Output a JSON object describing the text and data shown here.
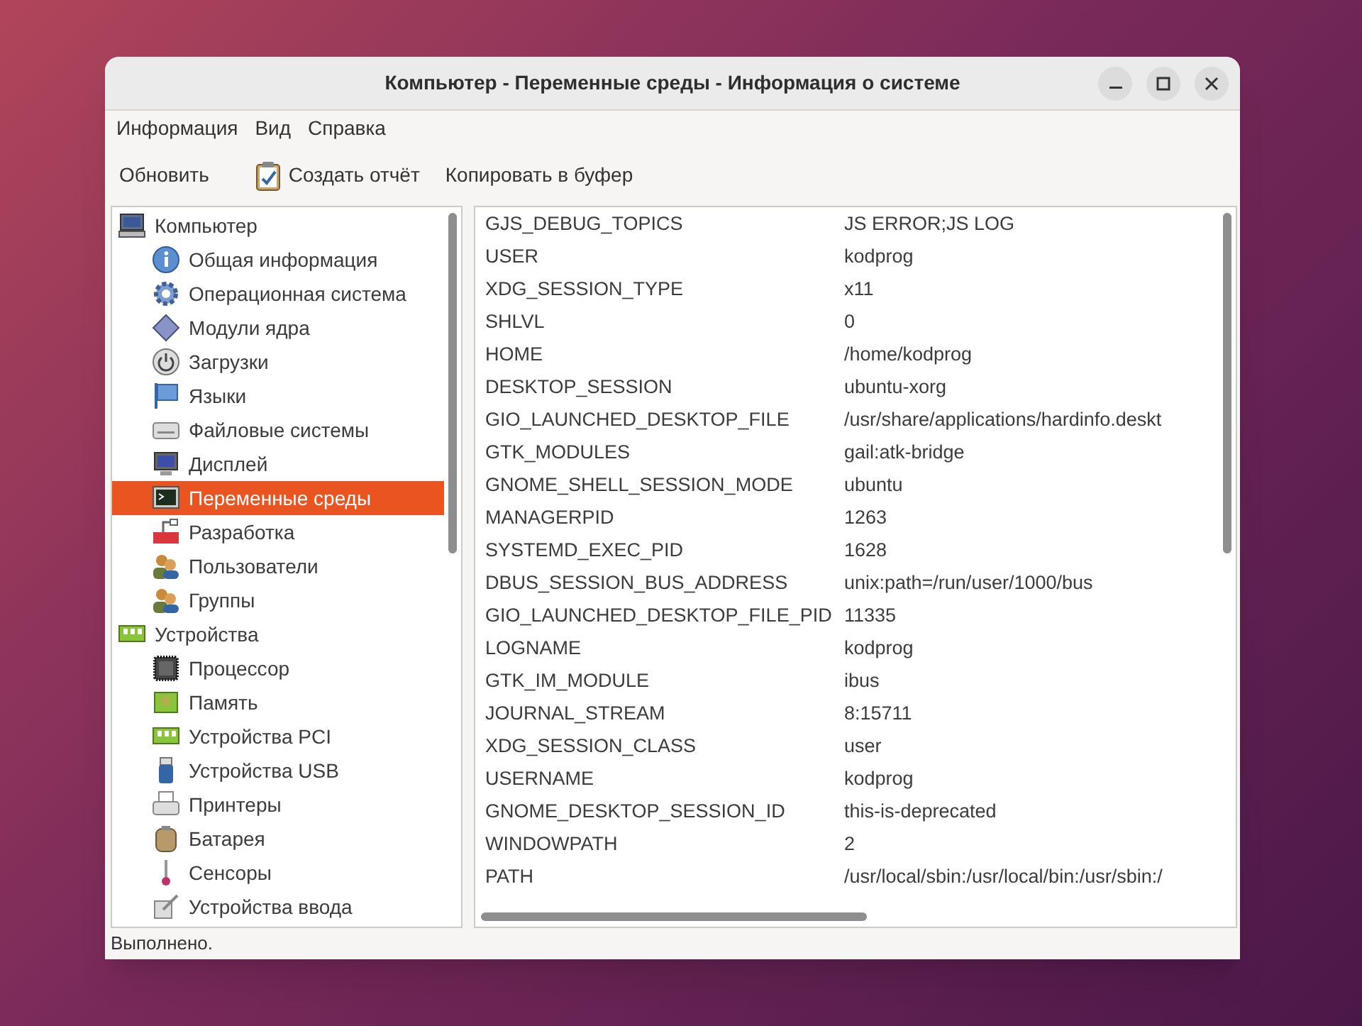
{
  "window": {
    "title": "Компьютер - Переменные среды - Информация о системе"
  },
  "menu": [
    "Информация",
    "Вид",
    "Справка"
  ],
  "toolbar": [
    {
      "label": "Обновить",
      "kind": "plain"
    },
    {
      "label": "Создать отчёт",
      "kind": "report"
    },
    {
      "label": "Копировать в буфер",
      "kind": "plain"
    }
  ],
  "sidebar": {
    "items": [
      {
        "label": "Компьютер",
        "kind": "computer",
        "selected": false,
        "children": [
          {
            "label": "Общая информация",
            "kind": "info",
            "selected": false
          },
          {
            "label": "Операционная система",
            "kind": "gear",
            "selected": false
          },
          {
            "label": "Модули ядра",
            "kind": "diamond",
            "selected": false
          },
          {
            "label": "Загрузки",
            "kind": "power",
            "selected": false
          },
          {
            "label": "Языки",
            "kind": "flag",
            "selected": false
          },
          {
            "label": "Файловые системы",
            "kind": "drive",
            "selected": false
          },
          {
            "label": "Дисплей",
            "kind": "monitor",
            "selected": false
          },
          {
            "label": "Переменные среды",
            "kind": "terminal",
            "selected": true
          },
          {
            "label": "Разработка",
            "kind": "devel",
            "selected": false
          },
          {
            "label": "Пользователи",
            "kind": "users",
            "selected": false
          },
          {
            "label": "Группы",
            "kind": "users",
            "selected": false
          }
        ]
      },
      {
        "label": "Устройства",
        "kind": "board",
        "selected": false,
        "children": [
          {
            "label": "Процессор",
            "kind": "chip",
            "selected": false
          },
          {
            "label": "Память",
            "kind": "memory",
            "selected": false
          },
          {
            "label": "Устройства PCI",
            "kind": "board",
            "selected": false
          },
          {
            "label": "Устройства USB",
            "kind": "usb",
            "selected": false
          },
          {
            "label": "Принтеры",
            "kind": "printer",
            "selected": false
          },
          {
            "label": "Батарея",
            "kind": "battery",
            "selected": false
          },
          {
            "label": "Сенсоры",
            "kind": "thermometer",
            "selected": false
          },
          {
            "label": "Устройства ввода",
            "kind": "input",
            "selected": false
          }
        ]
      }
    ]
  },
  "table": {
    "rows": [
      {
        "name": "GJS_DEBUG_TOPICS",
        "value": "JS ERROR;JS LOG"
      },
      {
        "name": "USER",
        "value": "kodprog"
      },
      {
        "name": "XDG_SESSION_TYPE",
        "value": "x11"
      },
      {
        "name": "SHLVL",
        "value": "0"
      },
      {
        "name": "HOME",
        "value": "/home/kodprog"
      },
      {
        "name": "DESKTOP_SESSION",
        "value": "ubuntu-xorg"
      },
      {
        "name": "GIO_LAUNCHED_DESKTOP_FILE",
        "value": "/usr/share/applications/hardinfo.deskt"
      },
      {
        "name": "GTK_MODULES",
        "value": "gail:atk-bridge"
      },
      {
        "name": "GNOME_SHELL_SESSION_MODE",
        "value": "ubuntu"
      },
      {
        "name": "MANAGERPID",
        "value": "1263"
      },
      {
        "name": "SYSTEMD_EXEC_PID",
        "value": "1628"
      },
      {
        "name": "DBUS_SESSION_BUS_ADDRESS",
        "value": "unix:path=/run/user/1000/bus"
      },
      {
        "name": "GIO_LAUNCHED_DESKTOP_FILE_PID",
        "value": "11335"
      },
      {
        "name": "LOGNAME",
        "value": "kodprog"
      },
      {
        "name": "GTK_IM_MODULE",
        "value": "ibus"
      },
      {
        "name": "JOURNAL_STREAM",
        "value": "8:15711"
      },
      {
        "name": "XDG_SESSION_CLASS",
        "value": "user"
      },
      {
        "name": "USERNAME",
        "value": "kodprog"
      },
      {
        "name": "GNOME_DESKTOP_SESSION_ID",
        "value": "this-is-deprecated"
      },
      {
        "name": "WINDOWPATH",
        "value": "2"
      },
      {
        "name": "PATH",
        "value": "/usr/local/sbin:/usr/local/bin:/usr/sbin:/"
      }
    ]
  },
  "status_bar": "Выполнено."
}
